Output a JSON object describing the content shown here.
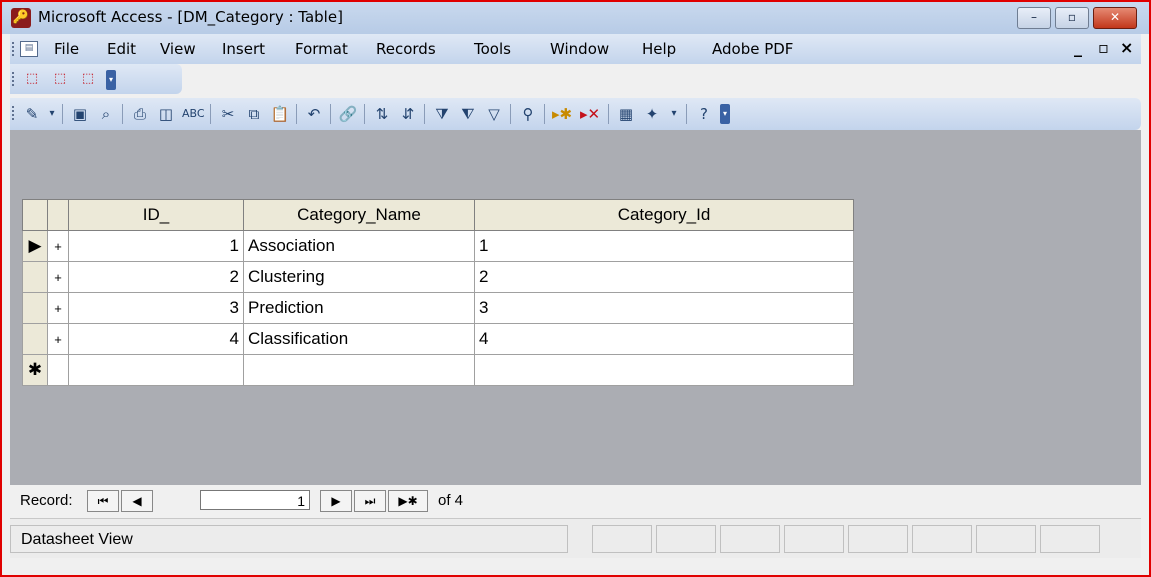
{
  "window": {
    "title": "Microsoft Access - [DM_Category : Table]",
    "minimize": "–",
    "restore": "▫",
    "close": "✕"
  },
  "menubar": {
    "items": [
      "File",
      "Edit",
      "View",
      "Insert",
      "Format",
      "Records",
      "Tools",
      "Window",
      "Help",
      "Adobe PDF"
    ],
    "right_minimize": "_",
    "right_restore": "▫",
    "right_close": "×"
  },
  "pdf_toolbar": {
    "icons": [
      "pdf-convert-icon",
      "pdf-email-icon",
      "pdf-review-icon"
    ]
  },
  "datasheet_toolbar": {
    "icons": [
      "view-design-icon",
      "save-icon",
      "search-icon",
      "print-icon",
      "print-preview-icon",
      "spelling-icon",
      "cut-icon",
      "copy-icon",
      "paste-icon",
      "undo-icon",
      "hyperlink-icon",
      "sort-ascending-icon",
      "sort-descending-icon",
      "filter-by-selection-icon",
      "filter-by-form-icon",
      "apply-filter-icon",
      "find-icon",
      "new-record-icon",
      "delete-record-icon",
      "database-window-icon",
      "new-object-icon",
      "help-icon"
    ]
  },
  "table": {
    "columns": [
      "ID_",
      "Category_Name",
      "Category_Id"
    ],
    "rows": [
      {
        "id": "1",
        "name": "Association",
        "category_id": "1"
      },
      {
        "id": "2",
        "name": "Clustering",
        "category_id": "2"
      },
      {
        "id": "3",
        "name": "Prediction",
        "category_id": "3"
      },
      {
        "id": "4",
        "name": "Classification",
        "category_id": "4"
      }
    ],
    "current_row_marker": "▶",
    "expand_marker": "+",
    "new_row_marker": "✱"
  },
  "record_nav": {
    "label": "Record:",
    "current": "1",
    "of_text": "of 4"
  },
  "status": {
    "text": "Datasheet View"
  }
}
